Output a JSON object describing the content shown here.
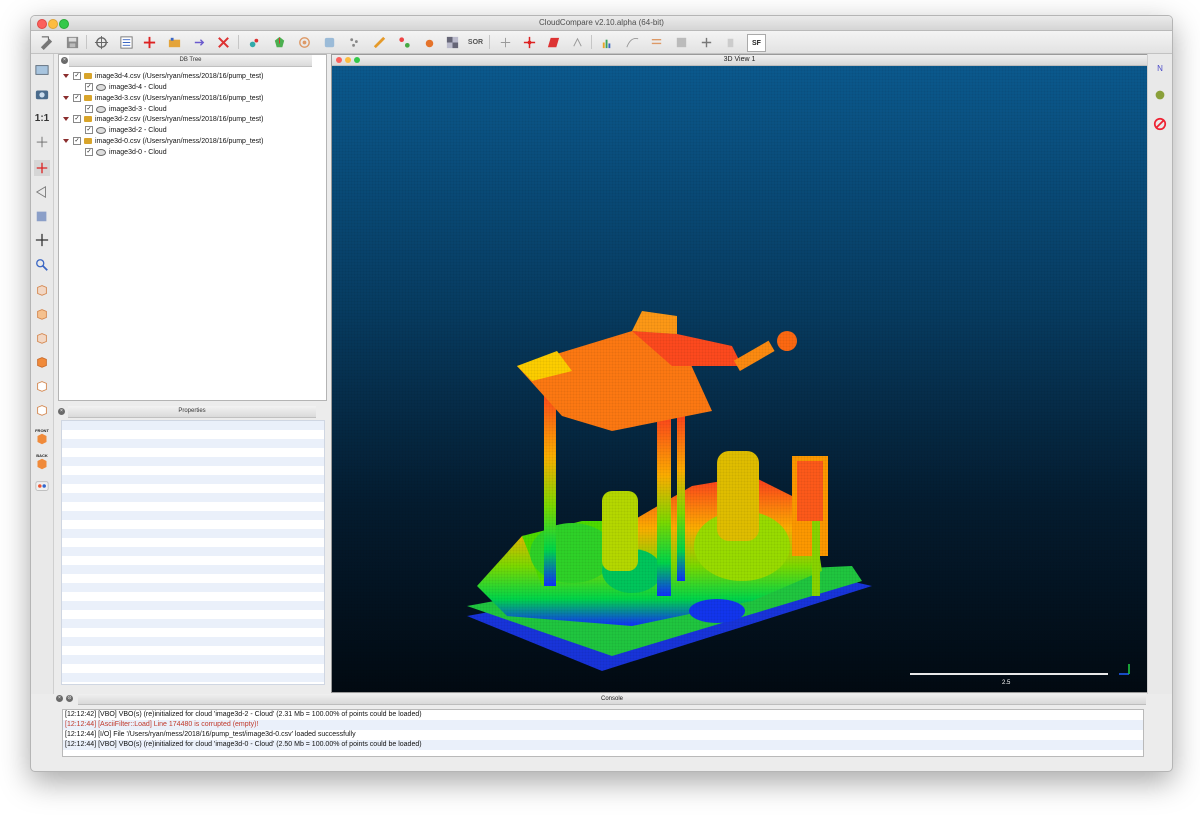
{
  "window": {
    "title": "CloudCompare v2.10.alpha (64-bit)"
  },
  "db_tree": {
    "title": "DB Tree",
    "items": [
      {
        "label": "image3d-4.csv (/Users/ryan/mess/2018/16/pump_test)",
        "child": "image3d-4 - Cloud"
      },
      {
        "label": "image3d-3.csv (/Users/ryan/mess/2018/16/pump_test)",
        "child": "image3d-3 - Cloud"
      },
      {
        "label": "image3d-2.csv (/Users/ryan/mess/2018/16/pump_test)",
        "child": "image3d-2 - Cloud"
      },
      {
        "label": "image3d-0.csv (/Users/ryan/mess/2018/16/pump_test)",
        "child": "image3d-0 - Cloud"
      }
    ]
  },
  "properties": {
    "title": "Properties"
  },
  "view": {
    "title": "3D View 1",
    "scale_label": "2.5",
    "colors": {
      "top": "#0b5a8f",
      "bottom": "#020a12"
    }
  },
  "left_toolbar": {
    "front_label": "FRONT",
    "back_label": "BACK",
    "ratio_label": "1:1"
  },
  "main_toolbar": {
    "sor_label": "SOR",
    "sf_label": "SF"
  },
  "right_toolbar": {
    "north_label": "N"
  },
  "console": {
    "title": "Console",
    "lines": [
      "[12:12:42] [VBO] VBO(s) (re)initialized for cloud 'image3d-2 - Cloud' (2.31 Mb = 100.00% of points could be loaded)",
      "[12:12:44] [AsciiFilter::Load] Line 174480 is corrupted (empty)!",
      "[12:12:44] [I/O] File '/Users/ryan/mess/2018/16/pump_test/image3d-0.csv' loaded successfully",
      "[12:12:44] [VBO] VBO(s) (re)initialized for cloud 'image3d-0 - Cloud' (2.50 Mb = 100.00% of points could be loaded)"
    ]
  }
}
